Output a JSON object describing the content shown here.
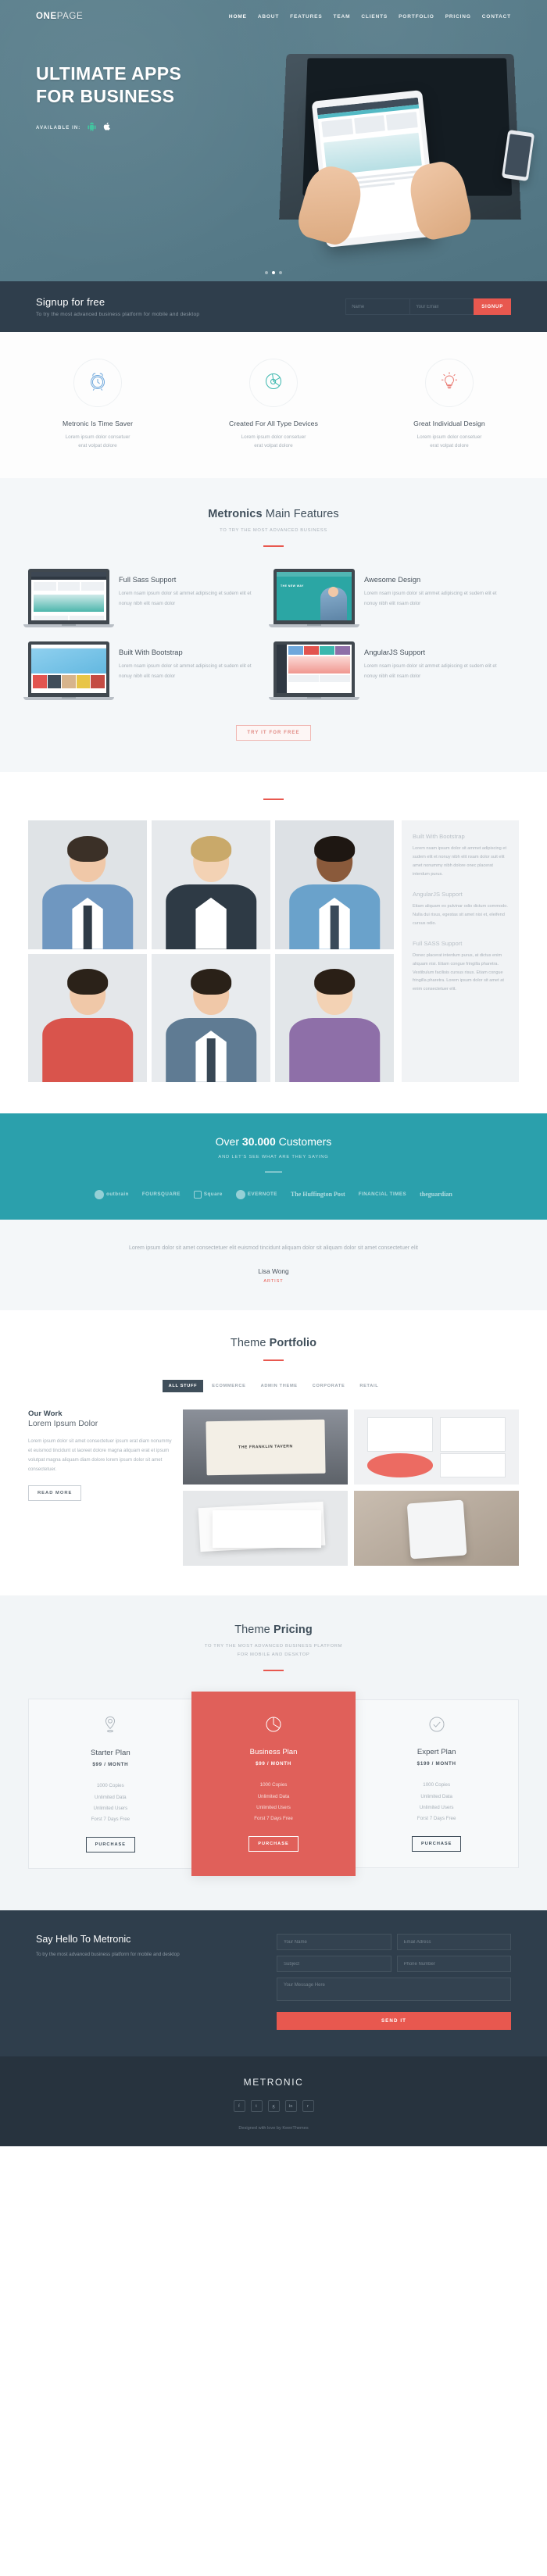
{
  "nav": {
    "logo_bold": "ONE",
    "logo_light": "PAGE",
    "items": [
      {
        "label": "HOME"
      },
      {
        "label": "ABOUT"
      },
      {
        "label": "FEATURES"
      },
      {
        "label": "TEAM"
      },
      {
        "label": "CLIENTS"
      },
      {
        "label": "PORTFOLIO"
      },
      {
        "label": "PRICING"
      },
      {
        "label": "CONTACT"
      }
    ]
  },
  "hero": {
    "title_line1": "ULTIMATE APPS",
    "title_line2": "FOR BUSINESS",
    "available_label": "AVAILABLE IN:",
    "store_android": "android-icon",
    "store_apple": "apple-icon",
    "slide_count": 3,
    "active_slide": 2
  },
  "signup": {
    "title": "Signup for free",
    "subtitle": "To try the most advanced business platform for mobile and desktop",
    "name_placeholder": "Name",
    "email_placeholder": "Your Email",
    "button": "SIGNUP",
    "accent": "#e8584f"
  },
  "services": [
    {
      "icon": "alarm-clock-icon",
      "icon_color": "#6fa8dc",
      "title": "Metronic Is Time Saver",
      "desc_line1": "Lorem ipsum dolor consetuer",
      "desc_line2": "erat volpat dolore"
    },
    {
      "icon": "pie-chart-icon",
      "icon_color": "#3bb7ae",
      "title": "Created For All Type Devices",
      "desc_line1": "Lorem ipsum dolor consetuer",
      "desc_line2": "erat volpat dolore"
    },
    {
      "icon": "lightbulb-icon",
      "icon_color": "#e8736b",
      "title": "Great Individual Design",
      "desc_line1": "Lorem ipsum dolor consetuer",
      "desc_line2": "erat volpat dolore"
    }
  ],
  "features_section": {
    "title_bold": "Metronics",
    "title_rest": " Main Features",
    "subtitle": "TO TRY THE MOST ADVANCED BUSINESS",
    "items": [
      {
        "art": "admin-dashboard-mockup",
        "title": "Full Sass Support",
        "desc": "Lorem nsam ipsum dolor sit ammet adipiscing et sudem elit et nonuy nibh elit nsam dolor"
      },
      {
        "art": "landing-page-mockup",
        "title": "Awesome Design",
        "desc": "Lorem nsam ipsum dolor sit ammet adipiscing et sudem elit et nonuy nibh elit nsam dolor",
        "art_caption": "THE NEW WAY"
      },
      {
        "art": "ecommerce-shop-mockup",
        "title": "Built With Bootstrap",
        "desc": "Lorem nsam ipsum dolor sit ammet adipiscing et sudem elit et nonuy nibh elit nsam dolor"
      },
      {
        "art": "analytics-dashboard-mockup",
        "title": "AngularJS Support",
        "desc": "Lorem nsam ipsum dolor sit ammet adipiscing et sudem elit et nonuy nibh elit nsam dolor"
      }
    ],
    "cta": "TRY IT FOR FREE"
  },
  "team": {
    "members": [
      {
        "name": "team-member-1",
        "shirt": "#6f97c0",
        "skin": "#f0c8a8",
        "hair": "#3b3027",
        "bg": "#dfe3e6",
        "tie": "#2f3b47"
      },
      {
        "name": "team-member-2",
        "shirt": "#2e3a45",
        "skin": "#f3d2b4",
        "hair": "#c9a96a",
        "bg": "#e6e9ec",
        "tie": "#2f3b47"
      },
      {
        "name": "team-member-3",
        "shirt": "#6aa2cb",
        "skin": "#8a5a3b",
        "hair": "#1e1712",
        "bg": "#dde1e5",
        "tie": "#3a4a5a"
      },
      {
        "name": "team-member-4",
        "shirt": "#d9544c",
        "skin": "#f0c8a8",
        "hair": "#2b2219",
        "bg": "#e4e7ea",
        "tie": "#c44b43"
      },
      {
        "name": "team-member-5",
        "shirt": "#5f7b93",
        "skin": "#f0c8a8",
        "hair": "#2a2118",
        "bg": "#e8ebee",
        "tie": "#384755"
      },
      {
        "name": "team-member-6",
        "shirt": "#8e6fa8",
        "skin": "#f3d2b4",
        "hair": "#2a1f16",
        "bg": "#e2e6e9",
        "tie": "#6d5386"
      }
    ],
    "side_blocks": [
      {
        "heading": "Built With Bootstrap",
        "text": "Lorem nsam ipsum dolor sit ammet adipiscing et sudem elit et nonuy nibh elit nsam dolor suit elit amet nonummy nibh dolore onec placerat interdum purus."
      },
      {
        "heading": "AngularJS Support",
        "text": "Etiam aliquam ex pulvinar odio dictum commodo. Nulla dui risus, egestas sit amet nisi et, eleifend cursus odio."
      },
      {
        "heading": "Full SASS Support",
        "text": "Donec placerat interdum purus, at dictus enim aliquam nisi. Etiam congue fringilla pharetra. Vestibulum facilisis cursus risus. Etiam congue fringilla pharetra. Lorem ipsum dolor sit amet at enim consectetuer elit."
      }
    ]
  },
  "customers": {
    "title_pre": "Over ",
    "title_count": "30.000",
    "title_post": " Customers",
    "subtitle": "AND LET'S SEE WHAT ARE THEY SAYING",
    "bg": "#2ba0ac",
    "logos": [
      {
        "label": "outbrain",
        "kind": "badge"
      },
      {
        "label": "FOURSQUARE",
        "kind": "text"
      },
      {
        "label": "Square",
        "kind": "sq"
      },
      {
        "label": "EVERNOTE",
        "kind": "badge"
      },
      {
        "label": "The Huffington Post",
        "kind": "serif"
      },
      {
        "label": "FINANCIAL TIMES",
        "kind": "text"
      },
      {
        "label": "theguardian",
        "kind": "serif"
      }
    ]
  },
  "testimonial": {
    "quote": "Lorem ipsum dolor sit amet consectetuer elit euismod tincidunt aliquam dolor sit aliquam dolor sit amet consectetuer elit",
    "name": "Lisa Wong",
    "role": "ARTIST"
  },
  "portfolio": {
    "title_pre": "Theme ",
    "title_bold": "Portfolio",
    "tabs": [
      {
        "label": "ALL STUFF",
        "active": true
      },
      {
        "label": "ECOMMERCE",
        "active": false
      },
      {
        "label": "ADMIN THEME",
        "active": false
      },
      {
        "label": "CORPORATE",
        "active": false
      },
      {
        "label": "RETAIL",
        "active": false
      }
    ],
    "work_kicker": "Our Work",
    "work_title": "Lorem Ipsum Dolor",
    "work_text": "Lorem ipsum dolor sit amet consectetuer ipsum erat diam nonummy et euismod tincidunt ut laoreet dolore magna aliquam erat et ipsum volutpat magna aliquam diam dolore lorem ipsum dolor sit amet consectetuer.",
    "work_button": "READ MORE",
    "items": [
      {
        "name": "portfolio-signage",
        "caption": "THE FRANKLIN TAVERN"
      },
      {
        "name": "portfolio-stationery"
      },
      {
        "name": "portfolio-print"
      },
      {
        "name": "portfolio-mobile"
      }
    ]
  },
  "pricing": {
    "title_pre": "Theme ",
    "title_bold": "Pricing",
    "subtitle_line1": "TO TRY THE MOST ADVANCED BUSINESS PLATFORM",
    "subtitle_line2": "FOR MOBILE AND DESKTOP",
    "plans": [
      {
        "icon": "map-pin-icon",
        "name": "Starter Plan",
        "price": "$99 / MONTH",
        "features": [
          "1000 Copies",
          "Unlimited Data",
          "Unlimited Users",
          "Forst 7 Days Free"
        ],
        "button": "PURCHASE",
        "featured": false
      },
      {
        "icon": "pie-chart-icon",
        "name": "Business Plan",
        "price": "$99 / MONTH",
        "features": [
          "1000 Copies",
          "Unlimited Data",
          "Unlimited Users",
          "Forst 7 Days Free"
        ],
        "button": "PURCHASE",
        "featured": true
      },
      {
        "icon": "check-circle-icon",
        "name": "Expert Plan",
        "price": "$199 / MONTH",
        "features": [
          "1000 Copies",
          "Unlimited Data",
          "Unlimited Users",
          "Forst 7 Days Free"
        ],
        "button": "PURCHASE",
        "featured": false
      }
    ],
    "featured_color": "#e0605a"
  },
  "contact": {
    "title": "Say Hello To Metronic",
    "subtitle": "To try the most advanced business platform for mobile and desktop",
    "name_placeholder": "Your Name",
    "email_placeholder": "Email Adress",
    "subject_placeholder": "Subject",
    "phone_placeholder": "Phone Number",
    "message_placeholder": "Your Message Here",
    "send_label": "SEND IT"
  },
  "footer": {
    "logo": "METRONIC",
    "social": [
      {
        "name": "facebook-icon",
        "glyph": "f"
      },
      {
        "name": "twitter-icon",
        "glyph": "t"
      },
      {
        "name": "google-plus-icon",
        "glyph": "g"
      },
      {
        "name": "linkedin-icon",
        "glyph": "in"
      },
      {
        "name": "rss-icon",
        "glyph": "r"
      }
    ],
    "copyright": "Designed with love by KeenThemes"
  }
}
